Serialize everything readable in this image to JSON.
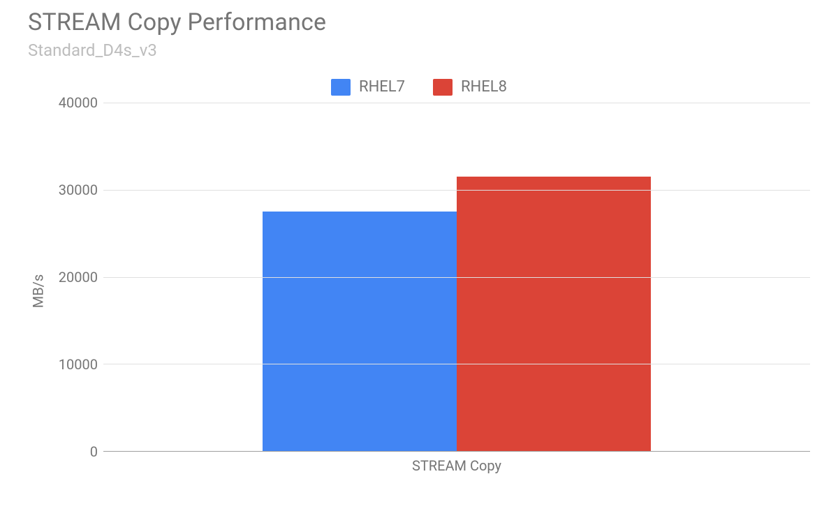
{
  "chart_data": {
    "type": "bar",
    "title": "STREAM Copy Performance",
    "subtitle": "Standard_D4s_v3",
    "categories": [
      "STREAM Copy"
    ],
    "series": [
      {
        "name": "RHEL7",
        "values": [
          27500
        ],
        "color": "#4285f4"
      },
      {
        "name": "RHEL8",
        "values": [
          31500
        ],
        "color": "#db4437"
      }
    ],
    "ylabel": "MB/s",
    "xlabel": "",
    "ylim": [
      0,
      40000
    ],
    "yticks": [
      0,
      10000,
      20000,
      30000,
      40000
    ]
  }
}
